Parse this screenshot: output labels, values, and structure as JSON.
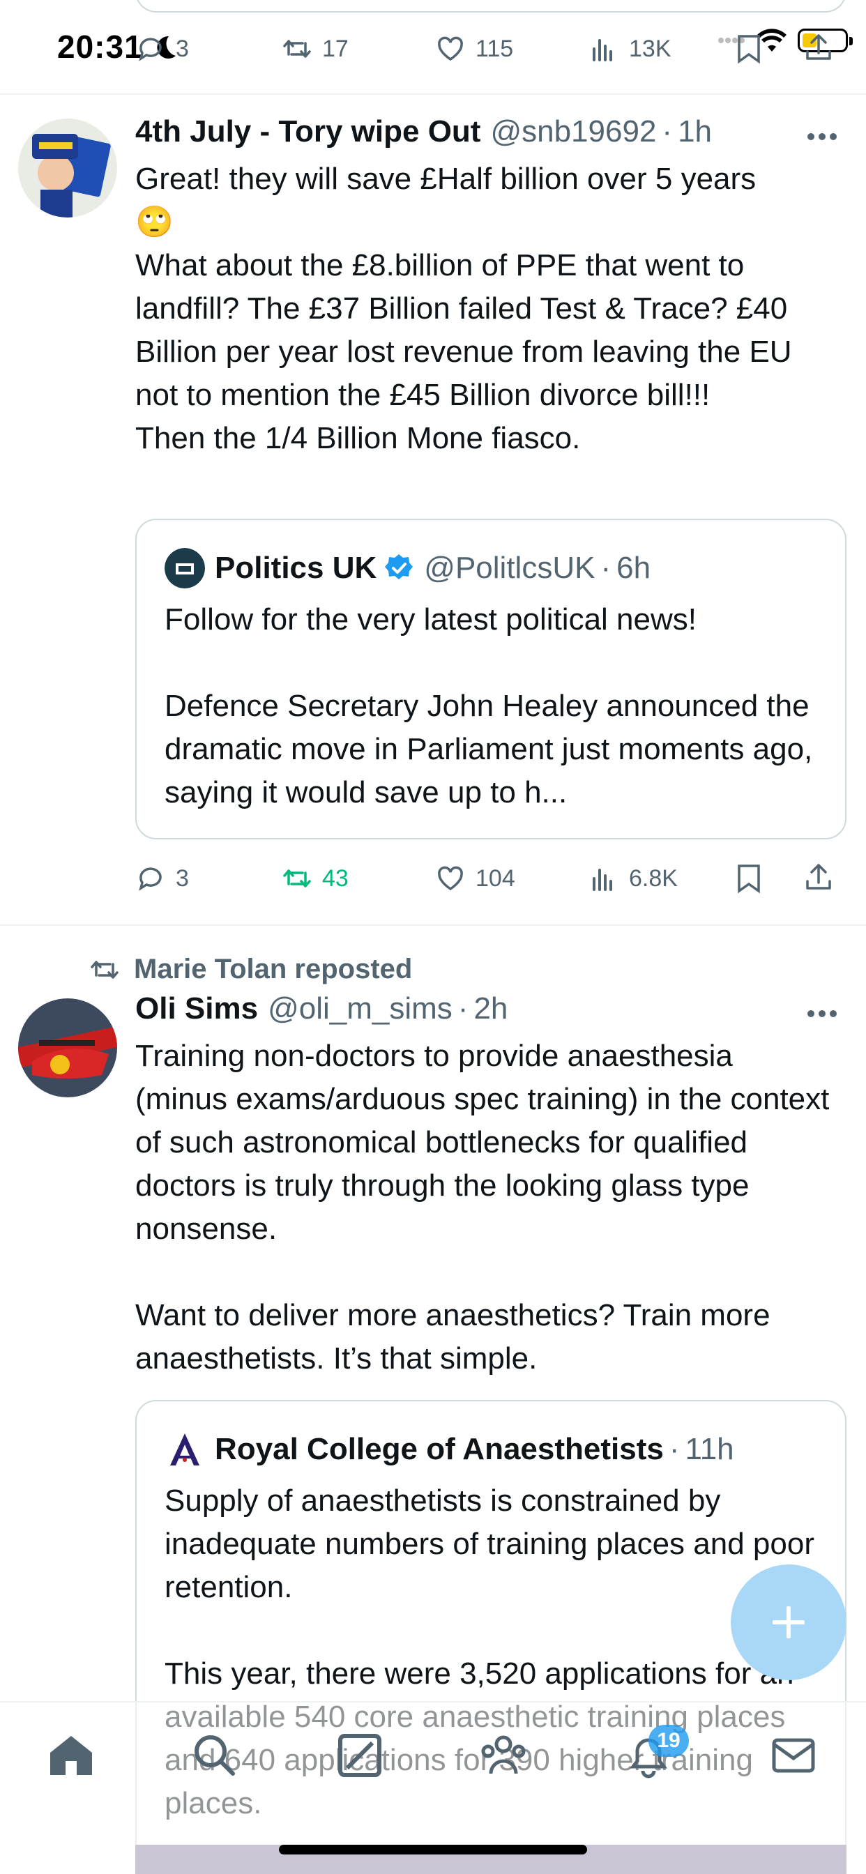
{
  "status_bar": {
    "time": "20:31"
  },
  "top_actions": {
    "replies": "3",
    "reposts": "17",
    "likes": "115",
    "views": "13K"
  },
  "tweets": [
    {
      "name": "4th July - Tory wipe Out",
      "handle": "@snb19692",
      "time": "1h",
      "text": "Great! they will save £Half billion over 5 years\n🙄\nWhat about the £8.billion of PPE that went to landfill? The £37 Billion failed Test & Trace? £40 Billion per year lost revenue from leaving the EU not to mention the £45 Billion divorce bill!!!\nThen the 1/4 Billion Mone fiasco.",
      "quote": {
        "name": "Politics UK",
        "handle": "@PolitlcsUK",
        "time": "6h",
        "text": "Follow for the very latest political news!\n\nDefence Secretary John Healey announced the dramatic move in Parliament just moments ago, saying it would save up to h..."
      },
      "actions": {
        "replies": "3",
        "reposts": "43",
        "likes": "104",
        "views": "6.8K"
      }
    },
    {
      "repost_by": "Marie Tolan reposted",
      "name": "Oli Sims",
      "handle": "@oli_m_sims",
      "time": "2h",
      "text": "Training non-doctors to provide anaesthesia (minus exams/arduous spec training) in the context of such astronomical bottlenecks for qualified doctors is truly through the looking glass type nonsense.\n\nWant to deliver more anaesthetics? Train more anaesthetists. It’s that simple.",
      "quote": {
        "name": "Royal College of Anaesthetists",
        "time": "11h",
        "text": "Supply of anaesthetists is constrained by inadequate numbers of training places and poor retention.\n\nThis year, there were 3,520 applications for an available 540 core anaesthetic training places and 640 applications for 390 higher training places."
      }
    }
  ],
  "nav": {
    "notifications_badge": "19"
  },
  "colors": {
    "accent": "#1d9bf0",
    "repost_active": "#00ba7c",
    "muted": "#536471"
  }
}
